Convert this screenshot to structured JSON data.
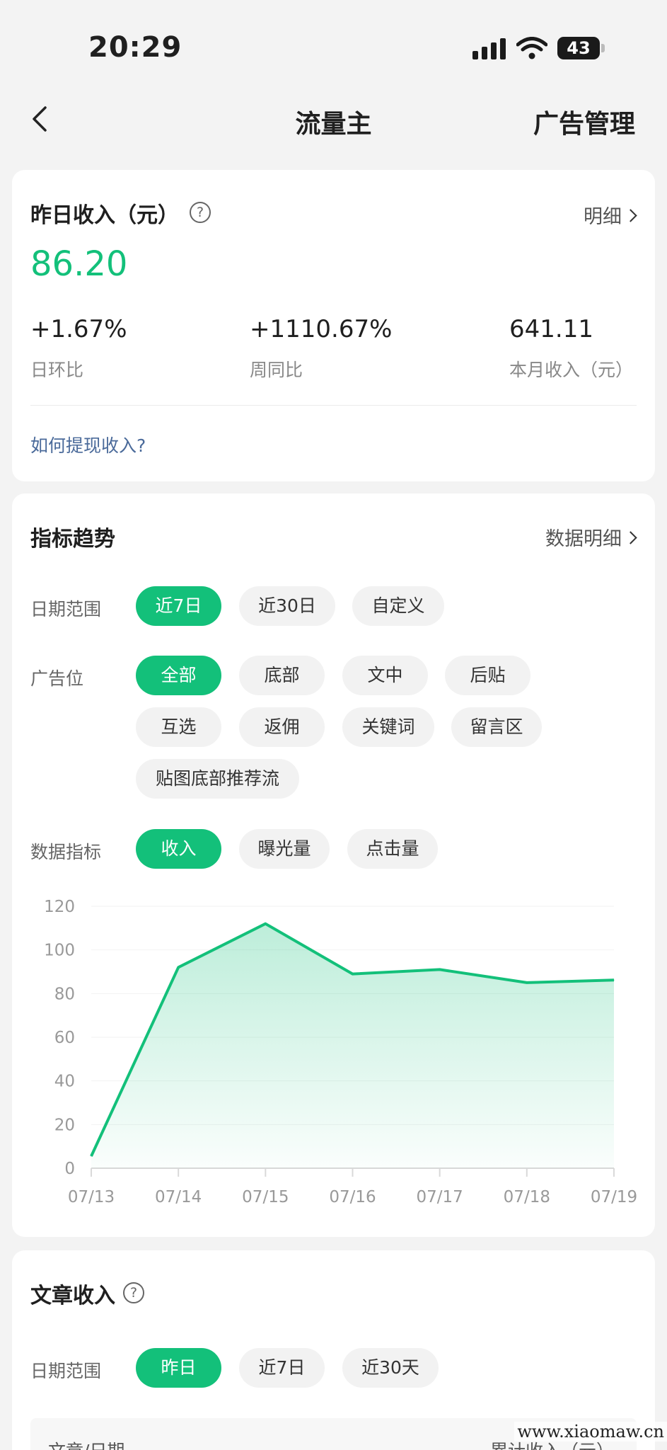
{
  "status_bar": {
    "time": "20:29",
    "battery": "43"
  },
  "nav": {
    "title": "流量主",
    "right_action": "广告管理"
  },
  "income_card": {
    "title": "昨日收入（元）",
    "detail_link": "明细",
    "yesterday_income": "86.20",
    "stats": [
      {
        "value": "+1.67%",
        "label": "日环比"
      },
      {
        "value": "+1110.67%",
        "label": "周同比"
      },
      {
        "value": "641.11",
        "label": "本月收入（元）"
      }
    ],
    "withdraw_link": "如何提现收入?"
  },
  "trend_card": {
    "title": "指标趋势",
    "detail_link": "数据明细",
    "date_range": {
      "label": "日期范围",
      "options": [
        "近7日",
        "近30日",
        "自定义"
      ],
      "selected": "近7日"
    },
    "ad_slot": {
      "label": "广告位",
      "options": [
        "全部",
        "底部",
        "文中",
        "后贴",
        "互选",
        "返佣",
        "关键词",
        "留言区",
        "贴图底部推荐流"
      ],
      "selected": "全部"
    },
    "metric": {
      "label": "数据指标",
      "options": [
        "收入",
        "曝光量",
        "点击量"
      ],
      "selected": "收入"
    }
  },
  "chart_data": {
    "type": "area",
    "title": "",
    "xlabel": "",
    "ylabel": "",
    "categories": [
      "07/13",
      "07/14",
      "07/15",
      "07/16",
      "07/17",
      "07/18",
      "07/19"
    ],
    "values": [
      5.5,
      92,
      112,
      89,
      91,
      85,
      86.2
    ],
    "ylim": [
      0,
      120
    ],
    "yticks": [
      "0",
      "20",
      "40",
      "60",
      "80",
      "100",
      "120"
    ],
    "grid": true,
    "color": "#13c07a"
  },
  "article_card": {
    "title": "文章收入",
    "date_range": {
      "label": "日期范围",
      "options": [
        "昨日",
        "近7日",
        "近30天"
      ],
      "selected": "昨日"
    },
    "table_headers": [
      "文章/日期",
      "累计收入（元）"
    ]
  },
  "watermark": "www.xiaomaw.cn",
  "colors": {
    "accent": "#13c07a",
    "link": "#4a6a9a",
    "background": "#f3f3f3"
  }
}
